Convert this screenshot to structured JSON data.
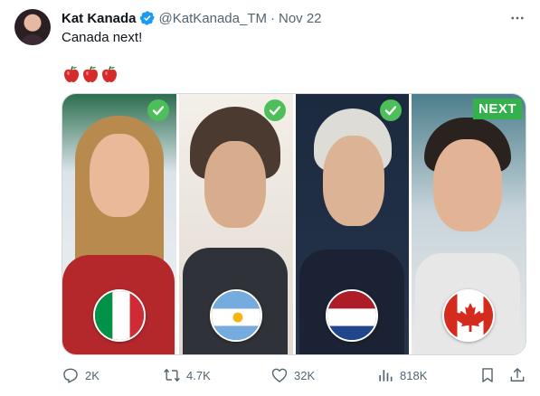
{
  "author": {
    "name": "Kat Kanada",
    "handle": "@KatKanada_TM",
    "separator": "·",
    "date": "Nov 22",
    "verified": true,
    "avatar_icon": "avatar-photo"
  },
  "tweet": {
    "text": "Canada next!",
    "emoji": "🍎🍎🍎",
    "emoji_icon": "red-apple-icon",
    "emoji_count": 3
  },
  "media": {
    "panels": [
      {
        "flag": "italy",
        "status": "check"
      },
      {
        "flag": "argentina",
        "status": "check"
      },
      {
        "flag": "netherlands",
        "status": "check"
      },
      {
        "flag": "canada",
        "status": "next",
        "badge_label": "NEXT"
      }
    ]
  },
  "actions": {
    "reply_count": "2K",
    "retweet_count": "4.7K",
    "like_count": "32K",
    "views_count": "818K"
  },
  "colors": {
    "text_primary": "#0f1419",
    "text_secondary": "#536471",
    "verified_blue": "#1d9bf0",
    "check_green": "#4cbf5a",
    "next_green": "#34b14b"
  }
}
